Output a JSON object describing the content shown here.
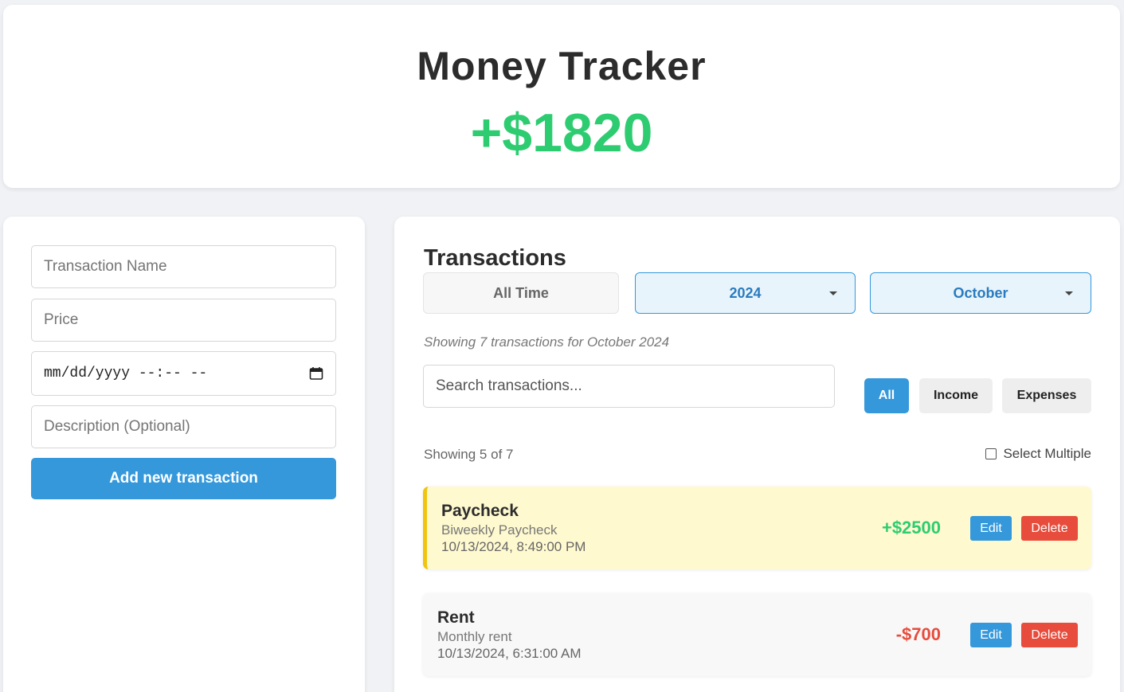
{
  "header": {
    "title": "Money Tracker",
    "balance": "+$1820",
    "balance_color": "#2ecc71"
  },
  "form": {
    "name_placeholder": "Transaction Name",
    "price_placeholder": "Price",
    "datetime_placeholder": "mm/dd/yyyy --:-- --",
    "description_placeholder": "Description (Optional)",
    "submit_label": "Add new transaction"
  },
  "transactions": {
    "title": "Transactions",
    "period_all_label": "All Time",
    "year_selected": "2024",
    "month_selected": "October",
    "showing_period": "Showing 7 transactions for October 2024",
    "search_placeholder": "Search transactions...",
    "filters": {
      "all": "All",
      "income": "Income",
      "expenses": "Expenses"
    },
    "active_filter": "All",
    "count_text": "Showing 5 of 7",
    "select_multiple_label": "Select Multiple",
    "items": [
      {
        "name": "Paycheck",
        "description": "Biweekly Paycheck",
        "datetime": "10/13/2024, 8:49:00 PM",
        "amount": "+$2500",
        "edit_label": "Edit",
        "delete_label": "Delete"
      },
      {
        "name": "Rent",
        "description": "Monthly rent",
        "datetime": "10/13/2024, 6:31:00 AM",
        "amount": "-$700",
        "edit_label": "Edit",
        "delete_label": "Delete"
      }
    ]
  },
  "colors": {
    "accent": "#3498db",
    "positive": "#2ecc71",
    "negative": "#e74c3c",
    "highlight": "#fef9cf"
  },
  "icons": [
    "calendar-icon",
    "chevron-down-icon",
    "checkbox-icon"
  ]
}
